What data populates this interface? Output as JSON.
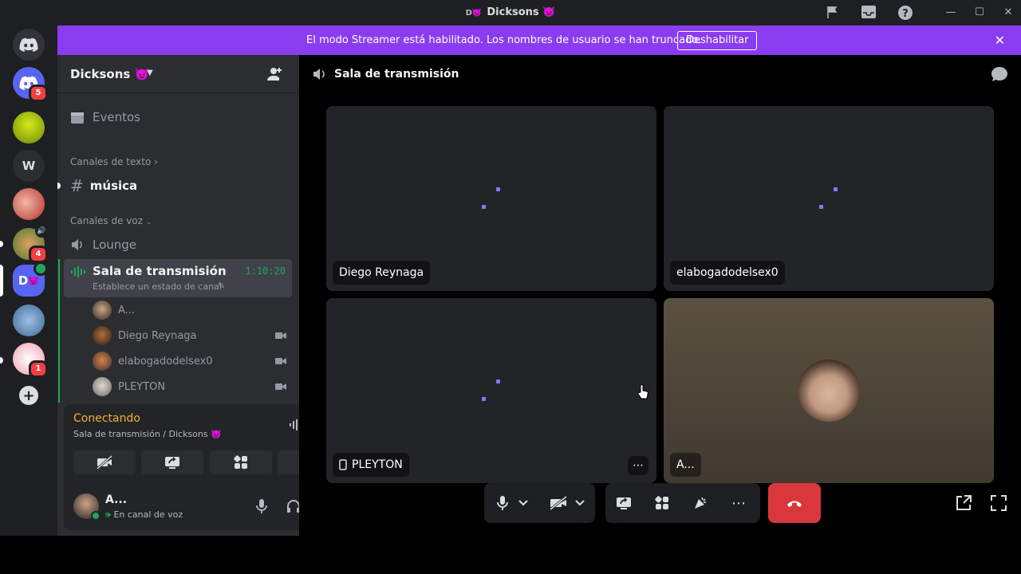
{
  "window": {
    "title": "Dicksons 👿",
    "title_prefix": "D👿",
    "minimize": "—",
    "maximize": "☐",
    "close": "✕"
  },
  "banner": {
    "message": "El modo Streamer está habilitado. Los nombres de usuario se han truncado.",
    "button": "Deshabilitar",
    "close": "✕"
  },
  "rail": {
    "servers": [
      {
        "label": "",
        "badge": "5"
      },
      {
        "label": ""
      },
      {
        "label": "W"
      },
      {
        "label": ""
      },
      {
        "label": "",
        "badge": "4"
      },
      {
        "label": "D"
      },
      {
        "label": ""
      },
      {
        "label": "",
        "badge": "1"
      }
    ],
    "add": "+"
  },
  "sidebar": {
    "guild_name": "Dicksons 👿",
    "events": "Eventos",
    "text_category": "Canales de texto",
    "text_channel": "música",
    "voice_category": "Canales de voz",
    "voice_channels": [
      {
        "name": "Lounge"
      },
      {
        "name": "Sala de transmisión",
        "timer": "1:10:20",
        "status": "Establece un estado de canal"
      }
    ],
    "members": [
      {
        "name": "A...",
        "camera": false
      },
      {
        "name": "Diego Reynaga",
        "camera": true
      },
      {
        "name": "elabogadodelsex0",
        "camera": true
      },
      {
        "name": "PLEYTON",
        "camera": true
      }
    ]
  },
  "voice_panel": {
    "status": "Conectando",
    "location": "Sala de transmisión / Dicksons 👿"
  },
  "user_panel": {
    "name": "A...",
    "status": "En canal de voz"
  },
  "main": {
    "channel_title": "Sala de transmisión",
    "tiles": [
      {
        "name": "Diego Reynaga"
      },
      {
        "name": "elabogadodelsex0"
      },
      {
        "name": "PLEYTON"
      },
      {
        "name": "A..."
      }
    ],
    "more": "⋯"
  },
  "colors": {
    "accent": "#8a3cf0",
    "danger": "#da373c",
    "online": "#23a55a",
    "loading_dot": "#8a76ff"
  }
}
